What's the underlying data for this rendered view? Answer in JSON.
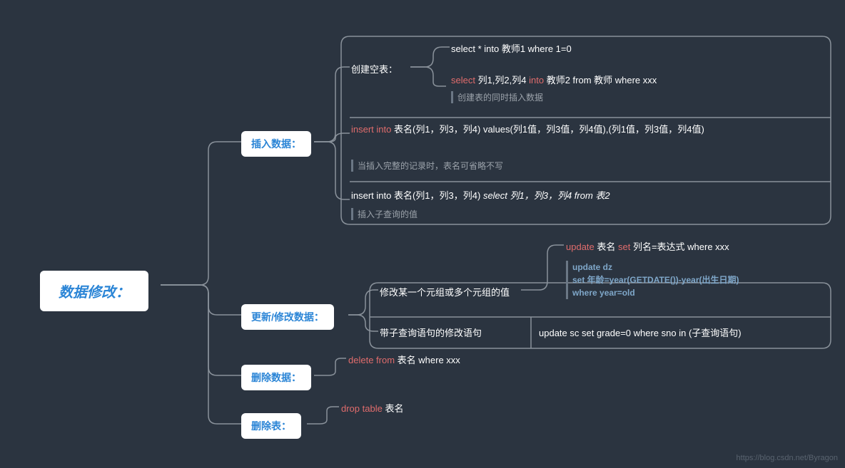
{
  "root": {
    "title": "数据修改："
  },
  "branches": {
    "insert": {
      "label": "插入数据："
    },
    "update": {
      "label": "更新/修改数据："
    },
    "deleteData": {
      "label": "删除数据："
    },
    "dropTable": {
      "label": "删除表："
    }
  },
  "createEmpty": {
    "label": "创建空表：",
    "line1": "select    *    into    教师1    where    1=0",
    "line2_a": "select",
    "line2_b": "   列1,列2,列4   ",
    "line2_c": "into",
    "line2_d": "   教师2    from    教师    where    xxx",
    "note": "创建表的同时插入数据"
  },
  "insertValues": {
    "a": "insert into",
    "b": " 表名(列1，列3，列4)    values(列1值，列3值，列4值),(列1值，列3值，列4值)",
    "note": "当插入完整的记录时，表名可省略不写"
  },
  "insertSelect": {
    "a": "insert into 表名(列1，列3，列4)   ",
    "b": "select  列1，列3，列4    from    表2",
    "note": "插入子查询的值"
  },
  "updateTop": {
    "a": "update",
    "b": "   表名   ",
    "c": "set",
    "d": "   列名=表达式      where    xxx",
    "code1": "update dz",
    "code2": "set 年龄=year(GETDATE())-year(出生日期)",
    "code3": "where year=old"
  },
  "updateMid": {
    "label": "修改某一个元组或多个元组的值"
  },
  "updateSub": {
    "label": "带子查询语句的修改语句",
    "stmt": "update   sc   set    grade=0    where   sno   in   (子查询语句)"
  },
  "deleteStmt": {
    "a": "delete",
    "b": "from",
    "c": "   表名    where    xxx"
  },
  "dropStmt": {
    "a": "drop",
    "b": "table",
    "c": "   表名"
  },
  "watermark": "https://blog.csdn.net/Byragon"
}
